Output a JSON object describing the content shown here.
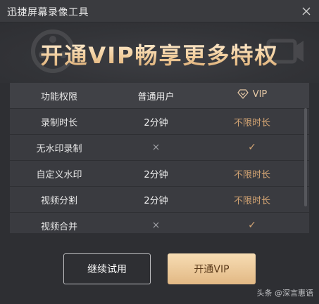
{
  "window": {
    "title": "迅捷屏幕录像工具"
  },
  "banner": {
    "headline": "开通VIP畅享更多特权"
  },
  "table": {
    "headers": {
      "feature": "功能权限",
      "normal": "普通用户",
      "vip": "VIP"
    },
    "rows": [
      {
        "feature": "录制时长",
        "normal": "2分钟",
        "vip": "不限时长"
      },
      {
        "feature": "无水印录制",
        "normal": "×",
        "vip": "✓"
      },
      {
        "feature": "自定义水印",
        "normal": "2分钟",
        "vip": "不限时长"
      },
      {
        "feature": "视频分割",
        "normal": "2分钟",
        "vip": "不限时长"
      },
      {
        "feature": "视频合并",
        "normal": "×",
        "vip": "✓"
      }
    ]
  },
  "buttons": {
    "trial": "继续试用",
    "open_vip": "开通VIP"
  },
  "watermark": "头条 @深言惠语",
  "colors": {
    "gold": "#d3a473",
    "background": "#2e2f33"
  },
  "icons": {
    "close": "close-icon",
    "vip": "diamond-icon",
    "unavailable": "cross-icon",
    "available": "check-icon"
  }
}
